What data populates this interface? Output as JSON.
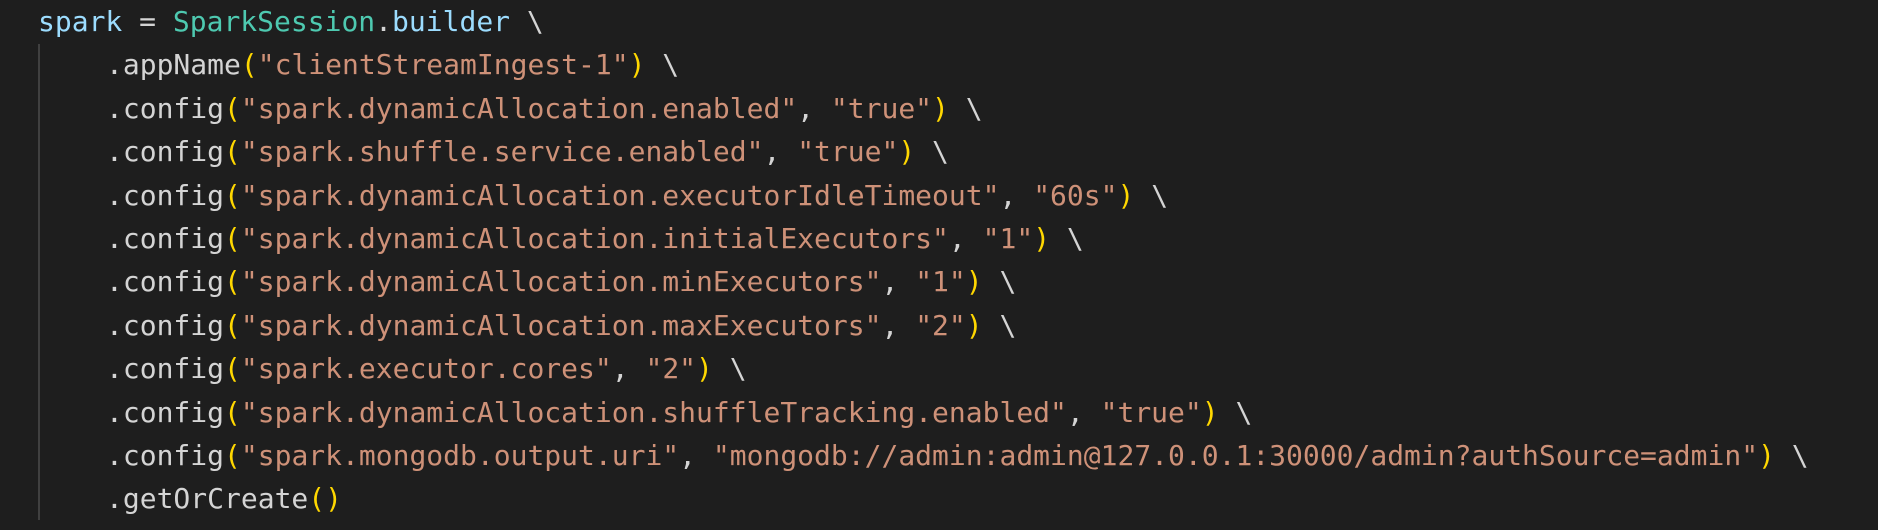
{
  "colors": {
    "background": "#1e1e1e",
    "variable": "#9cdcfe",
    "class": "#4ec9b0",
    "string": "#ce9178",
    "bracket": "#ffd700",
    "plain": "#d4d4d4"
  },
  "line0": {
    "var": "spark",
    "assign": " = ",
    "cls": "SparkSession",
    "dot": ".",
    "prop": "builder",
    "cont": " \\"
  },
  "lines": [
    {
      "method": ".appName",
      "open": "(",
      "arg1": "\"clientStreamIngest-1\"",
      "sep": "",
      "arg2": "",
      "close": ")",
      "cont": " \\"
    },
    {
      "method": ".config",
      "open": "(",
      "arg1": "\"spark.dynamicAllocation.enabled\"",
      "sep": ", ",
      "arg2": "\"true\"",
      "close": ")",
      "cont": " \\"
    },
    {
      "method": ".config",
      "open": "(",
      "arg1": "\"spark.shuffle.service.enabled\"",
      "sep": ", ",
      "arg2": "\"true\"",
      "close": ")",
      "cont": " \\"
    },
    {
      "method": ".config",
      "open": "(",
      "arg1": "\"spark.dynamicAllocation.executorIdleTimeout\"",
      "sep": ", ",
      "arg2": "\"60s\"",
      "close": ")",
      "cont": " \\"
    },
    {
      "method": ".config",
      "open": "(",
      "arg1": "\"spark.dynamicAllocation.initialExecutors\"",
      "sep": ", ",
      "arg2": "\"1\"",
      "close": ")",
      "cont": " \\"
    },
    {
      "method": ".config",
      "open": "(",
      "arg1": "\"spark.dynamicAllocation.minExecutors\"",
      "sep": ", ",
      "arg2": "\"1\"",
      "close": ")",
      "cont": " \\"
    },
    {
      "method": ".config",
      "open": "(",
      "arg1": "\"spark.dynamicAllocation.maxExecutors\"",
      "sep": ", ",
      "arg2": "\"2\"",
      "close": ")",
      "cont": " \\"
    },
    {
      "method": ".config",
      "open": "(",
      "arg1": "\"spark.executor.cores\"",
      "sep": ", ",
      "arg2": "\"2\"",
      "close": ")",
      "cont": " \\"
    },
    {
      "method": ".config",
      "open": "(",
      "arg1": "\"spark.dynamicAllocation.shuffleTracking.enabled\"",
      "sep": ", ",
      "arg2": "\"true\"",
      "close": ")",
      "cont": " \\"
    },
    {
      "method": ".config",
      "open": "(",
      "arg1": "\"spark.mongodb.output.uri\"",
      "sep": ", ",
      "arg2": "\"mongodb://admin:admin@127.0.0.1:30000/admin?authSource=admin\"",
      "close": ")",
      "cont": " \\"
    },
    {
      "method": ".getOrCreate",
      "open": "(",
      "arg1": "",
      "sep": "",
      "arg2": "",
      "close": ")",
      "cont": ""
    }
  ]
}
